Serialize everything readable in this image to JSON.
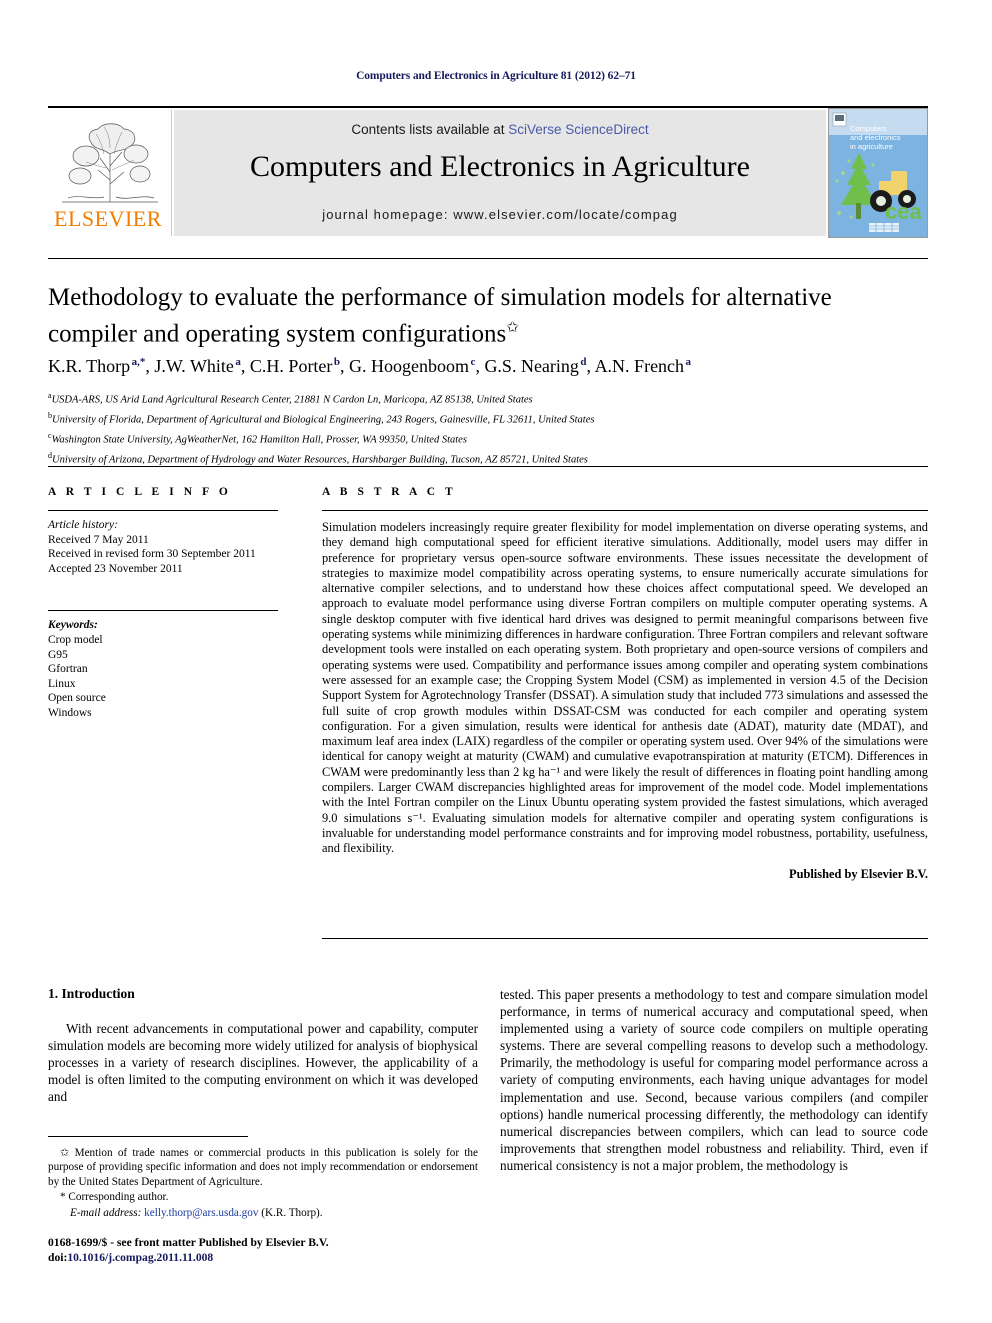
{
  "running_head": "Computers and Electronics in Agriculture 81 (2012) 62–71",
  "masthead": {
    "publisher_name": "ELSEVIER",
    "contents_prefix": "Contents lists available at ",
    "contents_link": "SciVerse ScienceDirect",
    "journal_title": "Computers and Electronics in Agriculture",
    "homepage": "journal homepage: www.elsevier.com/locate/compag",
    "cover": {
      "line1": "Computers",
      "line2": "and electronics",
      "line3": "in agriculture",
      "mark": "cea",
      "bg_color": "#7db3e0",
      "sky_color": "#c5dcf0"
    },
    "logo_color": "#f07d00",
    "band_color": "#e6e6e6"
  },
  "article": {
    "title": "Methodology to evaluate the performance of simulation models for alternative compiler and operating system configurations",
    "title_footnote_symbol": "✩",
    "authors": [
      {
        "name": "K.R. Thorp",
        "sup": "a,*"
      },
      {
        "name": "J.W. White",
        "sup": "a"
      },
      {
        "name": "C.H. Porter",
        "sup": "b"
      },
      {
        "name": "G. Hoogenboom",
        "sup": "c"
      },
      {
        "name": "G.S. Nearing",
        "sup": "d"
      },
      {
        "name": "A.N. French",
        "sup": "a"
      }
    ],
    "affiliations": [
      {
        "sup": "a",
        "text": "USDA-ARS, US Arid Land Agricultural Research Center, 21881 N Cardon Ln, Maricopa, AZ 85138, United States"
      },
      {
        "sup": "b",
        "text": "University of Florida, Department of Agricultural and Biological Engineering, 243 Rogers, Gainesville, FL 32611, United States"
      },
      {
        "sup": "c",
        "text": "Washington State University, AgWeatherNet, 162 Hamilton Hall, Prosser, WA 99350, United States"
      },
      {
        "sup": "d",
        "text": "University of Arizona, Department of Hydrology and Water Resources, Harshbarger Building, Tucson, AZ 85721, United States"
      }
    ]
  },
  "article_info": {
    "heading": "A R T I C L E    I N F O",
    "history_label": "Article history:",
    "history": [
      "Received 7 May 2011",
      "Received in revised form 30 September 2011",
      "Accepted 23 November 2011"
    ],
    "keywords_label": "Keywords:",
    "keywords": [
      "Crop model",
      "G95",
      "Gfortran",
      "Linux",
      "Open source",
      "Windows"
    ]
  },
  "abstract": {
    "heading": "A B S T R A C T",
    "text": "Simulation modelers increasingly require greater flexibility for model implementation on diverse operating systems, and they demand high computational speed for efficient iterative simulations. Additionally, model users may differ in preference for proprietary versus open-source software environments. These issues necessitate the development of strategies to maximize model compatibility across operating systems, to ensure numerically accurate simulations for alternative compiler selections, and to understand how these choices affect computational speed. We developed an approach to evaluate model performance using diverse Fortran compilers on multiple computer operating systems. A single desktop computer with five identical hard drives was designed to permit meaningful comparisons between five operating systems while minimizing differences in hardware configuration. Three Fortran compilers and relevant software development tools were installed on each operating system. Both proprietary and open-source versions of compilers and operating systems were used. Compatibility and performance issues among compiler and operating system combinations were assessed for an example case; the Cropping System Model (CSM) as implemented in version 4.5 of the Decision Support System for Agrotechnology Transfer (DSSAT). A simulation study that included 773 simulations and assessed the full suite of crop growth modules within DSSAT-CSM was conducted for each compiler and operating system configuration. For a given simulation, results were identical for anthesis date (ADAT), maturity date (MDAT), and maximum leaf area index (LAIX) regardless of the compiler or operating system used. Over 94% of the simulations were identical for canopy weight at maturity (CWAM) and cumulative evapotranspiration at maturity (ETCM). Differences in CWAM were predominantly less than 2 kg ha⁻¹ and were likely the result of differences in floating point handling among compilers. Larger CWAM discrepancies highlighted areas for improvement of the model code. Model implementations with the Intel Fortran compiler on the Linux Ubuntu operating system provided the fastest simulations, which averaged 9.0 simulations s⁻¹. Evaluating simulation models for alternative compiler and operating system configurations is invaluable for understanding model performance constraints and for improving model robustness, portability, usefulness, and flexibility.",
    "publisher_statement": "Published by Elsevier B.V."
  },
  "body": {
    "section_heading": "1. Introduction",
    "left_paragraph": "With recent advancements in computational power and capability, computer simulation models are becoming more widely utilized for analysis of biophysical processes in a variety of research disciplines. However, the applicability of a model is often limited to the computing environment on which it was developed and",
    "right_paragraph": "tested. This paper presents a methodology to test and compare simulation model performance, in terms of numerical accuracy and computational speed, when implemented using a variety of source code compilers on multiple operating systems. There are several compelling reasons to develop such a methodology. Primarily, the methodology is useful for comparing model performance across a variety of computing environments, each having unique advantages for model implementation and use. Second, because various compilers (and compiler options) handle numerical processing differently, the methodology can identify numerical discrepancies between compilers, which can lead to source code improvements that strengthen model robustness and reliability. Third, even if numerical consistency is not a major problem, the methodology is"
  },
  "footnotes": {
    "trade_symbol": "✩",
    "trade_note": "Mention of trade names or commercial products in this publication is solely for the purpose of providing specific information and does not imply recommendation or endorsement by the United States Department of Agriculture.",
    "corresponding_symbol": "*",
    "corresponding_note": "Corresponding author.",
    "email_label": "E-mail address:",
    "email": "kelly.thorp@ars.usda.gov",
    "email_attribution": "(K.R. Thorp).",
    "issn_line": "0168-1699/$ - see front matter Published by Elsevier B.V.",
    "doi_label": "doi:",
    "doi_value": "10.1016/j.compag.2011.11.008"
  }
}
